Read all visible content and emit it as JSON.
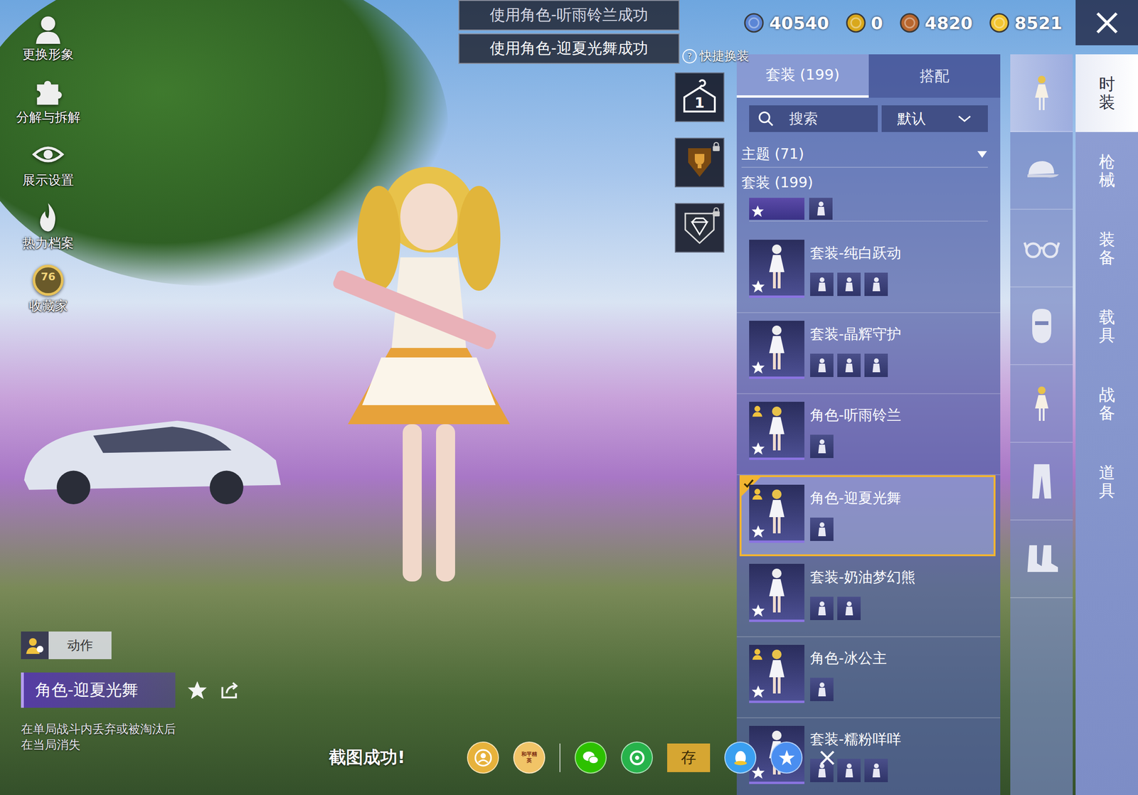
{
  "toasts": [
    "使用角色-听雨铃兰成功",
    "使用角色-迎夏光舞成功"
  ],
  "quick_outfit": {
    "label": "快捷换装",
    "help": "?"
  },
  "left_menu": [
    {
      "label": "更换形象"
    },
    {
      "label": "分解与拆解"
    },
    {
      "label": "展示设置"
    },
    {
      "label": "热力档案"
    },
    {
      "label": "收藏家",
      "badge": "76"
    }
  ],
  "currencies": [
    {
      "amount": "40540",
      "color": "#5b86d6"
    },
    {
      "amount": "0",
      "color": "#d9a81c"
    },
    {
      "amount": "4820",
      "color": "#b8662e"
    },
    {
      "amount": "8521",
      "color": "#f2c531"
    }
  ],
  "mid_tools": [
    {
      "kind": "hanger",
      "label": "1",
      "locked": false
    },
    {
      "kind": "trophy",
      "locked": true
    },
    {
      "kind": "diamond",
      "locked": true
    }
  ],
  "panel": {
    "tabs": [
      {
        "label": "套装 (199)",
        "selected": true
      },
      {
        "label": "搭配",
        "selected": false
      }
    ],
    "search": {
      "placeholder": "搜索"
    },
    "sort": {
      "value": "默认"
    },
    "theme": {
      "label": "主题 (71)",
      "expanded": false
    },
    "section": {
      "label": "套装 (199)",
      "parts": 1
    },
    "items": [
      {
        "title": "套装-纯白跃动",
        "kind": "suit",
        "parts": 3,
        "selected": false
      },
      {
        "title": "套装-晶辉守护",
        "kind": "suit",
        "parts": 3,
        "selected": false
      },
      {
        "title": "角色-听雨铃兰",
        "kind": "role",
        "parts": 1,
        "selected": false
      },
      {
        "title": "角色-迎夏光舞",
        "kind": "role",
        "parts": 1,
        "selected": true
      },
      {
        "title": "套装-奶油梦幻熊",
        "kind": "suit",
        "parts": 2,
        "selected": false
      },
      {
        "title": "角色-冰公主",
        "kind": "role",
        "parts": 1,
        "selected": false
      },
      {
        "title": "套装-糯粉咩咩",
        "kind": "suit",
        "parts": 3,
        "selected": false
      }
    ]
  },
  "categories": [
    {
      "selected": true
    },
    {
      "selected": false
    },
    {
      "selected": false
    },
    {
      "selected": false
    },
    {
      "selected": false
    },
    {
      "selected": false
    },
    {
      "selected": false
    }
  ],
  "side_tabs": [
    {
      "label": "时装",
      "selected": true
    },
    {
      "label": "枪械",
      "selected": false
    },
    {
      "label": "装备",
      "selected": false
    },
    {
      "label": "载具",
      "selected": false
    },
    {
      "label": "战备",
      "selected": false
    },
    {
      "label": "道具",
      "selected": false
    }
  ],
  "bottom_left": {
    "action": "动作",
    "name": "角色-迎夏光舞",
    "note": [
      "在单局战斗内丢弃或被淘汰后",
      "在当局消失"
    ]
  },
  "share_bar": {
    "status": "截图成功!",
    "save": "存",
    "targets": [
      {
        "kind": "avatar",
        "color": "#e7b23b"
      },
      {
        "kind": "game",
        "label": "和平精英",
        "color": "#f1c467"
      },
      {
        "kind": "wechat",
        "color": "#2dc100"
      },
      {
        "kind": "moments",
        "color": "#27b34b"
      },
      {
        "kind": "qq",
        "color": "#3a9ff0"
      },
      {
        "kind": "qzone",
        "color": "#4a8ef0"
      }
    ]
  }
}
